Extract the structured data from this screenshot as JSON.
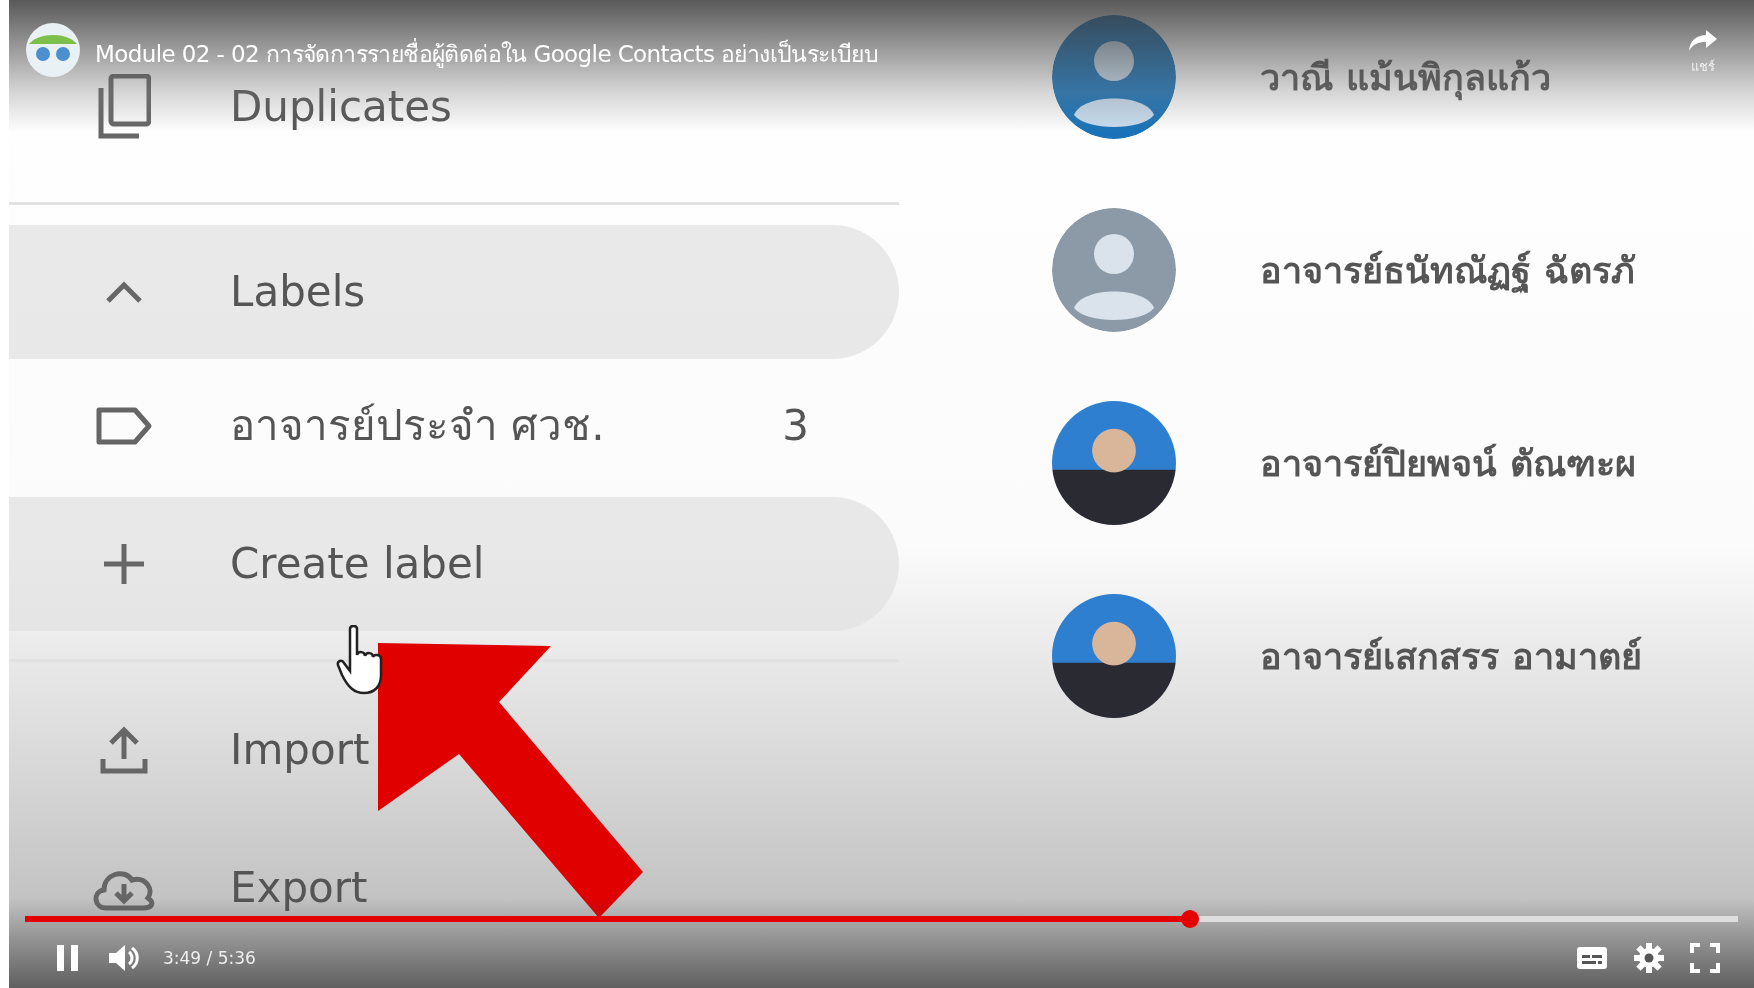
{
  "video": {
    "title": "Module 02 - 02 การจัดการรายชื่อผู้ติดต่อใน Google Contacts อย่างเป็นระเบียบ",
    "share_label": "แชร์"
  },
  "sidebar": {
    "items": [
      {
        "kind": "duplicates",
        "label": "Duplicates",
        "highlighted": false
      },
      {
        "kind": "divider"
      },
      {
        "kind": "section",
        "label": "Labels",
        "expanded": true,
        "highlighted": true
      },
      {
        "kind": "label",
        "label": "อาจารย์ประจำ ศวช.",
        "count": "3",
        "highlighted": false
      },
      {
        "kind": "create",
        "label": "Create label",
        "highlighted": true
      },
      {
        "kind": "divider"
      },
      {
        "kind": "import",
        "label": "Import",
        "highlighted": false
      },
      {
        "kind": "export",
        "label": "Export",
        "highlighted": false
      }
    ]
  },
  "contacts": [
    {
      "kind": "default",
      "color": "#1a73b8",
      "name": "วาณี แม้นพิกุลแก้ว"
    },
    {
      "kind": "default",
      "color": "#8b9aa6",
      "name": "อาจารย์ธนัทณัฏฐ์ ฉัตรภั"
    },
    {
      "kind": "photo",
      "name": "อาจารย์ปิยพจน์ ตัณฑะผ"
    },
    {
      "kind": "photo",
      "name": "อาจารย์เสกสรร อามาตย์"
    }
  ],
  "player": {
    "playing": true,
    "level": 0.68,
    "time": "3:49 / 5:36"
  }
}
